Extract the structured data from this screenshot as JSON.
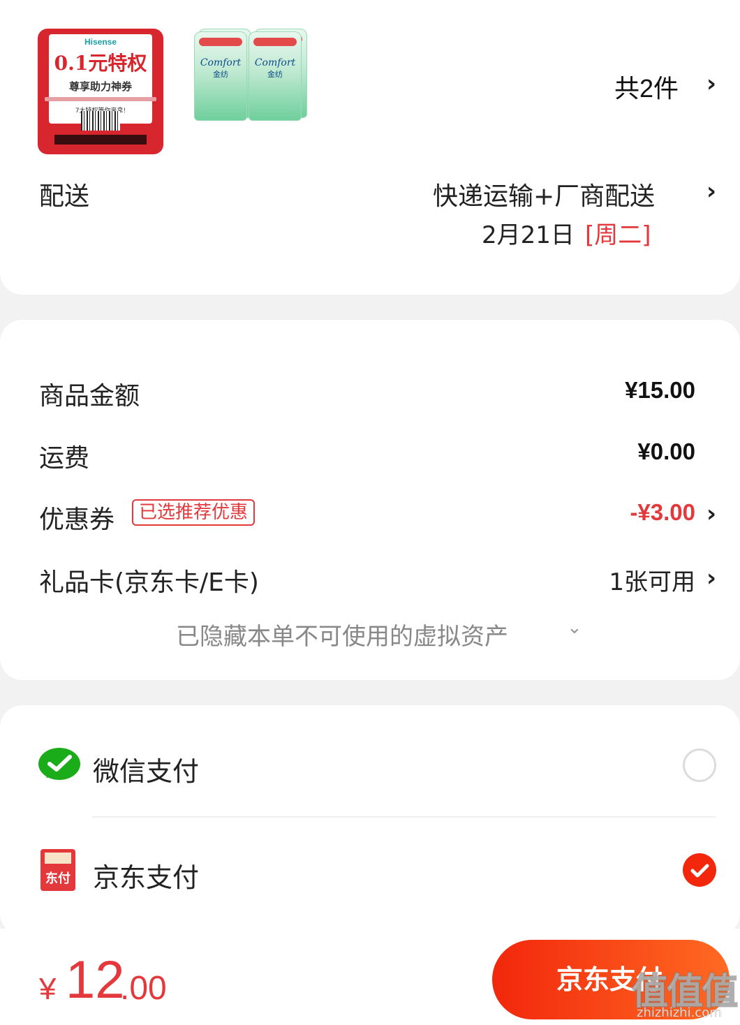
{
  "order": {
    "coupon_thumb": {
      "brand": "Hisense",
      "headline": "0.1元特权",
      "subline": "尊享助力神券",
      "small": "7大特权等你来拿!"
    },
    "comfort_thumb": {
      "logo": "Comfort",
      "cn": "金纺"
    },
    "items_count": "共2件",
    "delivery_label": "配送",
    "delivery_method": "快递运输+厂商配送",
    "delivery_date": "2月21日",
    "delivery_weekday": "[周二]"
  },
  "amounts": {
    "goods_label": "商品金额",
    "goods_value": "¥15.00",
    "shipping_label": "运费",
    "shipping_value": "¥0.00",
    "coupon_label": "优惠券",
    "coupon_tag": "已选推荐优惠",
    "coupon_value": "-¥3.00",
    "giftcard_label": "礼品卡(京东卡/E卡)",
    "giftcard_value": "1张可用",
    "hidden_assets": "已隐藏本单不可使用的虚拟资产"
  },
  "payment": {
    "wechat_label": "微信支付",
    "jd_label": "京东支付",
    "jd_icon_text": "东付",
    "wechat_selected": false,
    "jd_selected": true
  },
  "footer": {
    "currency": "¥",
    "total_int": "12",
    "total_dec": ".00",
    "pay_button": "京东支付"
  },
  "watermark": {
    "text": "值值值",
    "url": "zhizhizhi.com"
  },
  "colors": {
    "accent_red": "#e4393c",
    "button_red": "#f2270c",
    "wechat_green": "#1aad19"
  }
}
